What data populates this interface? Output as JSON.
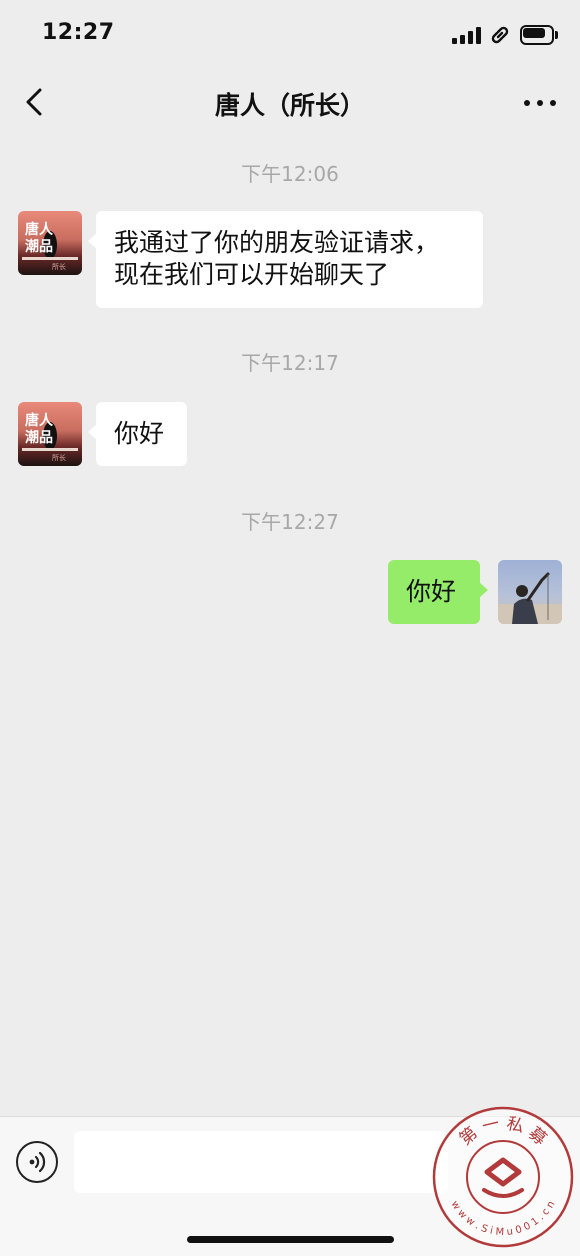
{
  "status_bar": {
    "time": "12:27"
  },
  "header": {
    "title": "唐人（所长）",
    "back_icon": "chevron-left-icon",
    "more_icon": "ellipsis-icon"
  },
  "messages": [
    {
      "kind": "timestamp",
      "text": "下午12:06"
    },
    {
      "kind": "incoming",
      "sender_avatar": "contact-avatar",
      "text": "我通过了你的朋友验证请求，\n现在我们可以开始聊天了"
    },
    {
      "kind": "timestamp",
      "text": "下午12:17"
    },
    {
      "kind": "incoming",
      "sender_avatar": "contact-avatar",
      "text": "你好"
    },
    {
      "kind": "timestamp",
      "text": "下午12:27"
    },
    {
      "kind": "outgoing",
      "sender_avatar": "self-avatar",
      "text": "你好"
    }
  ],
  "contact_avatar_text": [
    "唐人",
    "潮品",
    "所长"
  ],
  "input": {
    "value": "",
    "voice_icon": "voice-icon"
  },
  "watermark": {
    "top_text": "第 一 私 募",
    "bottom_text": "w w w . S i M u 0 0 1 . c n"
  },
  "colors": {
    "background": "#ededed",
    "incoming_bubble": "#ffffff",
    "outgoing_bubble": "#95ec69",
    "timestamp": "#a8a8a8",
    "watermark": "#b23a3a"
  }
}
